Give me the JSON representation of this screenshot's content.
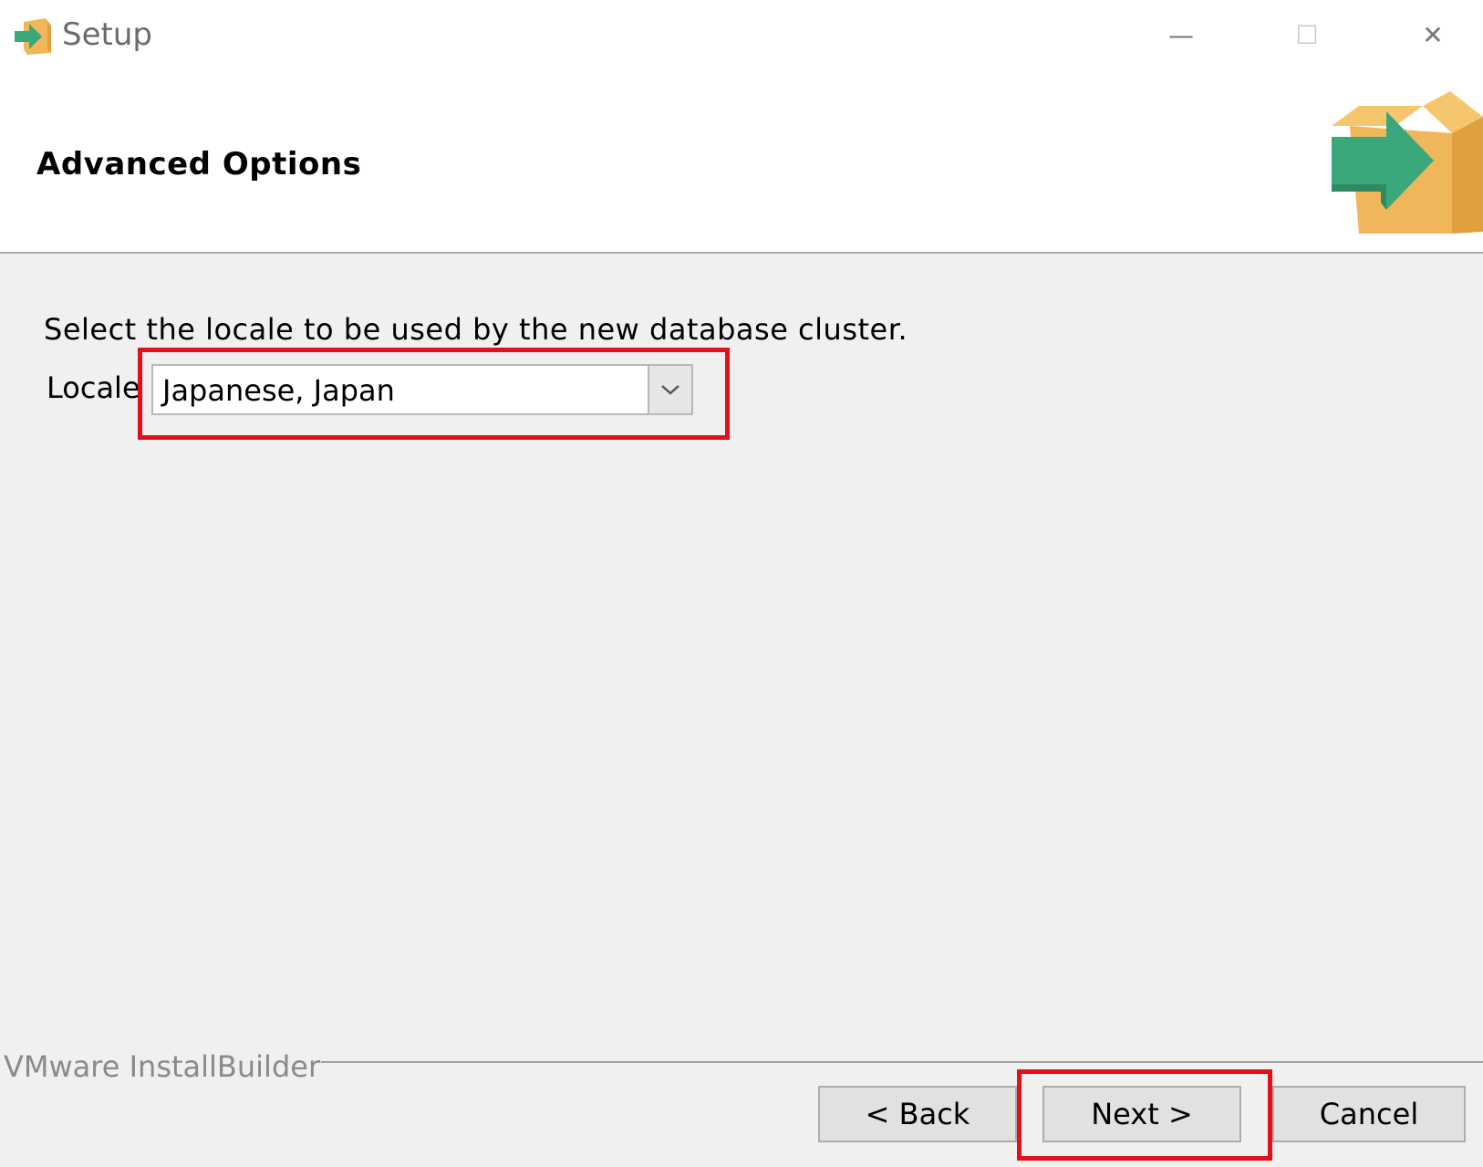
{
  "window": {
    "title": "Setup",
    "minimize_glyph": "—",
    "maximize_glyph": "☐",
    "close_glyph": "✕"
  },
  "header": {
    "title": "Advanced Options",
    "logo_icon": "installer-box-arrow-icon"
  },
  "main": {
    "description": "Select the locale to be used by the new database cluster.",
    "locale_label": "Locale",
    "locale_value": "Japanese, Japan"
  },
  "footer": {
    "brand": "VMware InstallBuilder",
    "back_label": "< Back",
    "next_label": "Next >",
    "cancel_label": "Cancel"
  },
  "colors": {
    "highlight": "#e3101a",
    "box": "#f0b75a",
    "arrow": "#3aa87a"
  }
}
